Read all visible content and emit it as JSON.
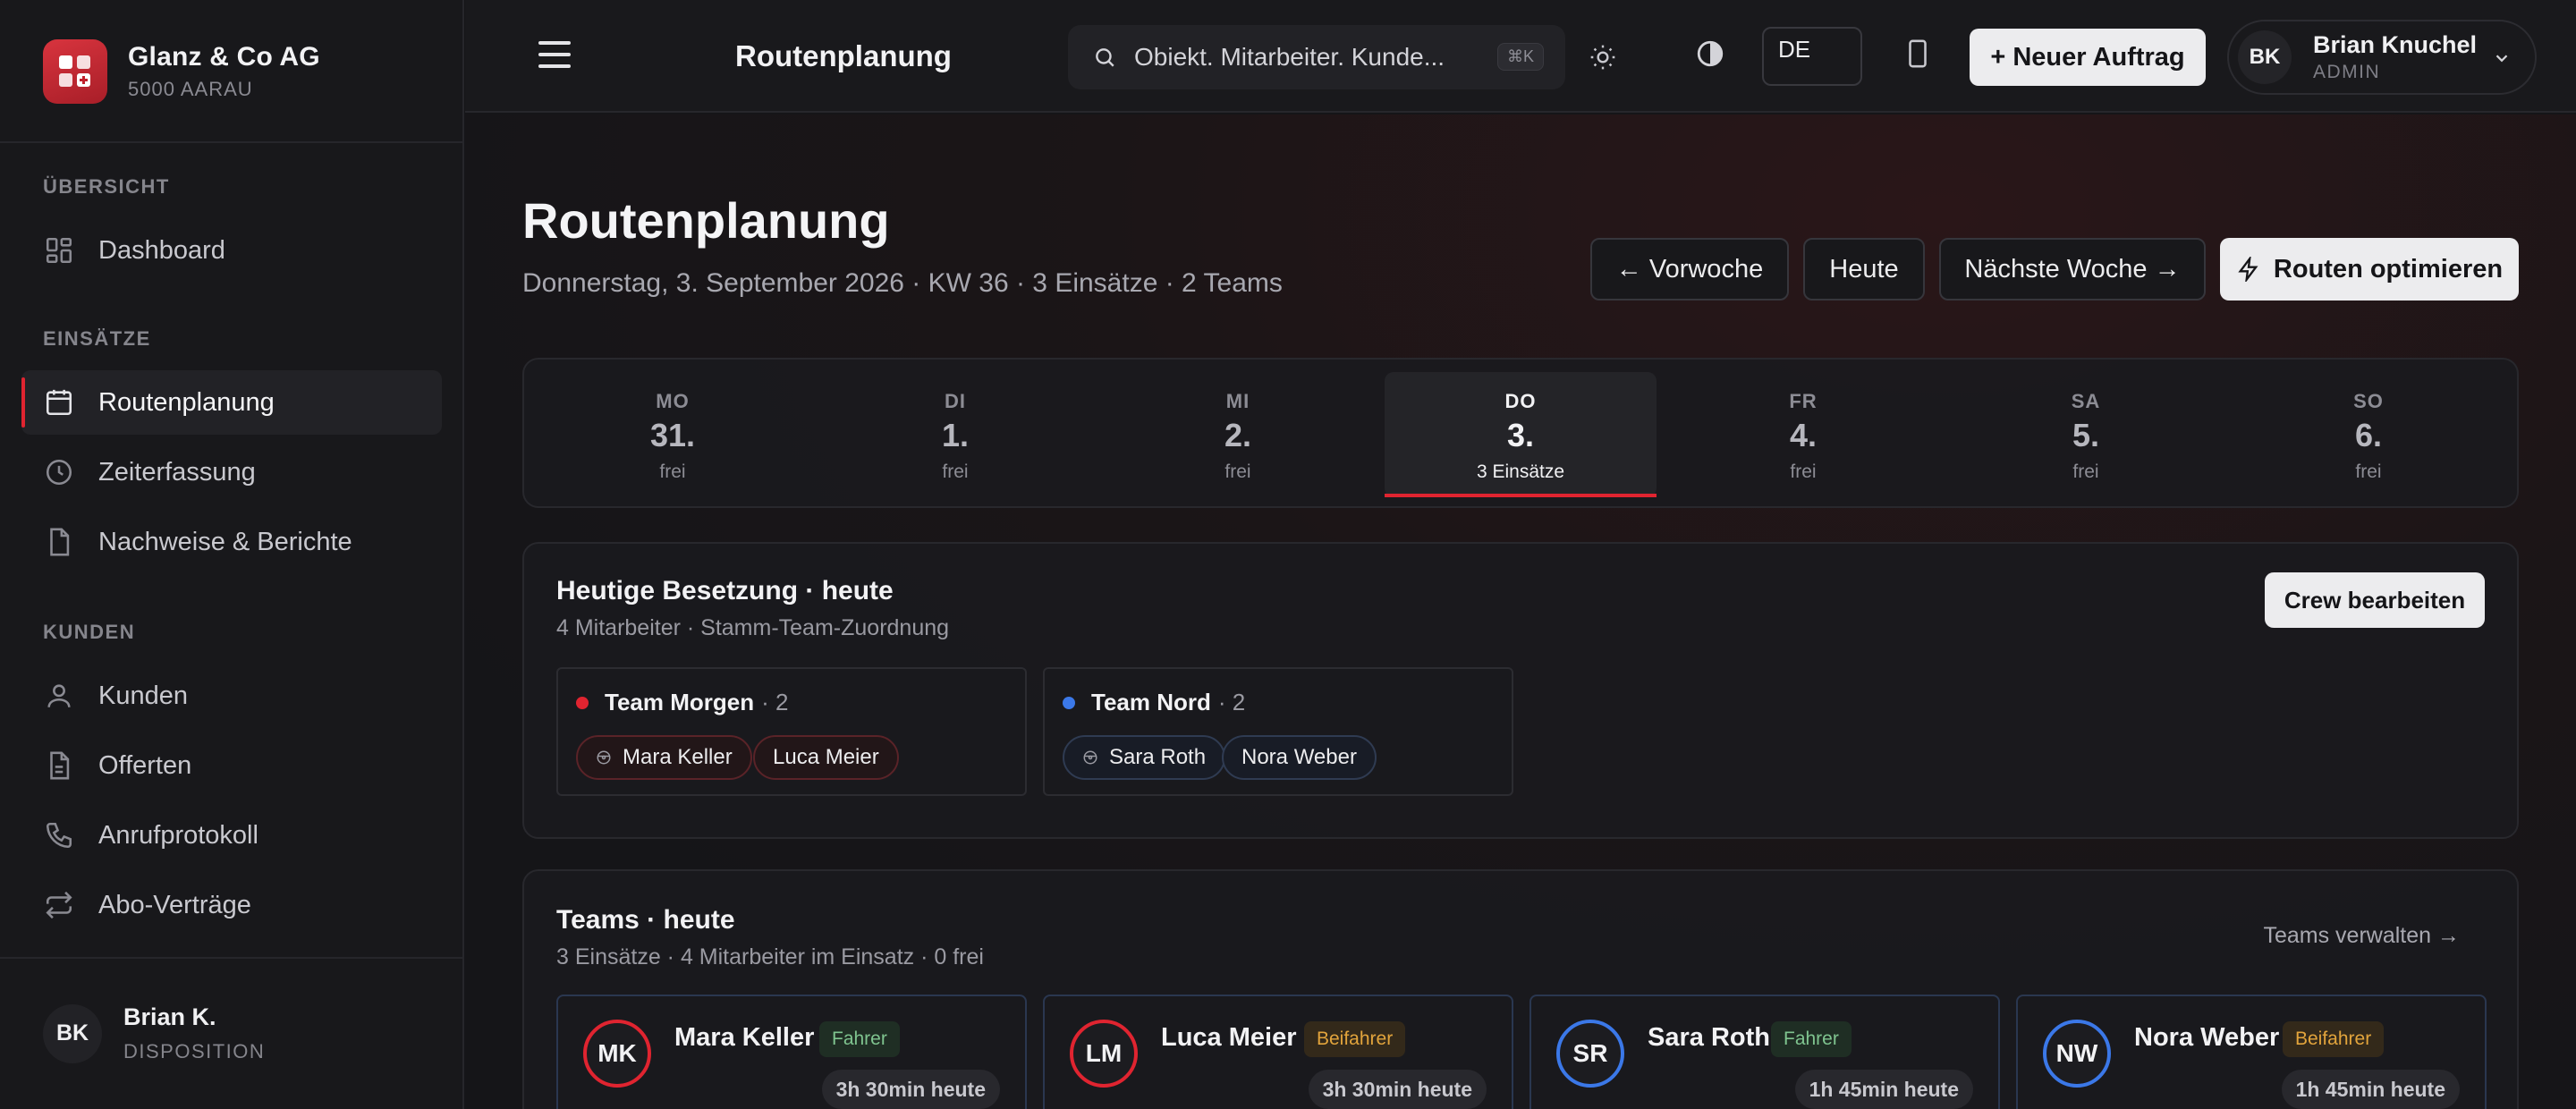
{
  "brand": {
    "name": "Glanz & Co AG",
    "sub": "5000 AARAU"
  },
  "sidebar": {
    "sections": [
      {
        "title": "ÜBERSICHT",
        "items": [
          {
            "label": "Dashboard",
            "icon": "dashboard-icon"
          }
        ]
      },
      {
        "title": "EINSÄTZE",
        "items": [
          {
            "label": "Routenplanung",
            "icon": "calendar-icon",
            "active": true
          },
          {
            "label": "Zeiterfassung",
            "icon": "clock-icon"
          },
          {
            "label": "Nachweise & Berichte",
            "icon": "document-icon"
          }
        ]
      },
      {
        "title": "KUNDEN",
        "items": [
          {
            "label": "Kunden",
            "icon": "user-icon"
          },
          {
            "label": "Offerten",
            "icon": "file-text-icon"
          },
          {
            "label": "Anrufprotokoll",
            "icon": "phone-icon"
          },
          {
            "label": "Abo-Verträge",
            "icon": "repeat-icon"
          }
        ]
      }
    ],
    "user": {
      "initials": "BK",
      "name": "Brian K.",
      "role": "DISPOSITION"
    }
  },
  "topbar": {
    "title": "Routenplanung",
    "search": {
      "text": "Obiekt. Mitarbeiter. Kunde...",
      "shortcut": "⌘K"
    },
    "language": "DE",
    "new_button": "+ Neuer Auftrag",
    "user": {
      "initials": "BK",
      "name": "Brian Knuchel",
      "role": "ADMIN"
    }
  },
  "header": {
    "title": "Routenplanung",
    "subtitle": "Donnerstag, 3. September 2026 · KW 36 · 3 Einsätze · 2 Teams",
    "buttons": {
      "prev": "← Vorwoche",
      "today": "Heute",
      "next": "Nächste Woche →",
      "optimize": "Routen optimieren"
    }
  },
  "week": [
    {
      "abbr": "MO",
      "num": "31.",
      "status": "frei"
    },
    {
      "abbr": "DI",
      "num": "1.",
      "status": "frei"
    },
    {
      "abbr": "MI",
      "num": "2.",
      "status": "frei"
    },
    {
      "abbr": "DO",
      "num": "3.",
      "status": "3 Einsätze",
      "selected": true
    },
    {
      "abbr": "FR",
      "num": "4.",
      "status": "frei"
    },
    {
      "abbr": "SA",
      "num": "5.",
      "status": "frei"
    },
    {
      "abbr": "SO",
      "num": "6.",
      "status": "frei"
    }
  ],
  "staffing": {
    "title": "Heutige Besetzung · heute",
    "subtitle": "4 Mitarbeiter · Stamm-Team-Zuordnung",
    "edit_button": "Crew bearbeiten",
    "teams": [
      {
        "name": "Team Morgen",
        "count": "· 2",
        "color": "#e02430",
        "members": [
          "Mara Keller",
          "Luca Meier"
        ]
      },
      {
        "name": "Team Nord",
        "count": "· 2",
        "color": "#3b78e8",
        "members": [
          "Sara Roth",
          "Nora Weber"
        ]
      }
    ]
  },
  "teams_today": {
    "title": "Teams · heute",
    "subtitle": "3 Einsätze · 4 Mitarbeiter im Einsatz · 0 frei",
    "manage_link": "Teams verwalten →",
    "members": [
      {
        "initials": "MK",
        "name": "Mara Keller",
        "role": "Fahrer",
        "time": "3h 30min heute",
        "color": "#e02430"
      },
      {
        "initials": "LM",
        "name": "Luca Meier",
        "role": "Beifahrer",
        "time": "3h 30min heute",
        "color": "#e02430"
      },
      {
        "initials": "SR",
        "name": "Sara Roth",
        "role": "Fahrer",
        "time": "1h 45min heute",
        "color": "#3b78e8"
      },
      {
        "initials": "NW",
        "name": "Nora Weber",
        "role": "Beifahrer",
        "time": "1h 45min heute",
        "color": "#3b78e8"
      }
    ]
  }
}
